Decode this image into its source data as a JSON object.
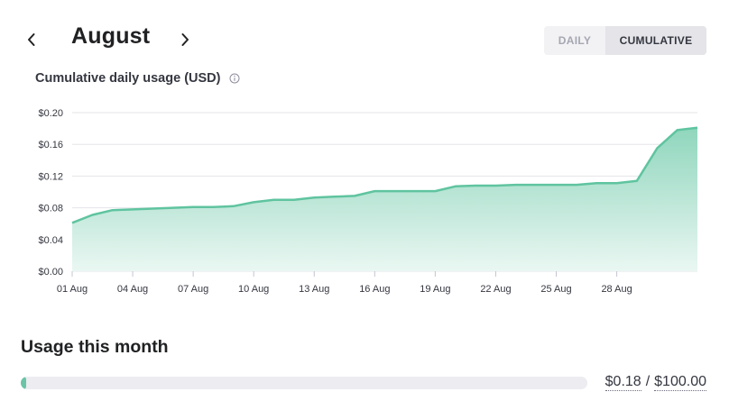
{
  "header": {
    "month": "August",
    "toggle": {
      "daily_label": "DAILY",
      "cumulative_label": "CUMULATIVE",
      "active": "cumulative"
    }
  },
  "chart_data": {
    "type": "area",
    "title": "Cumulative daily usage (USD)",
    "x": [
      "01 Aug",
      "02 Aug",
      "03 Aug",
      "04 Aug",
      "05 Aug",
      "06 Aug",
      "07 Aug",
      "08 Aug",
      "09 Aug",
      "10 Aug",
      "11 Aug",
      "12 Aug",
      "13 Aug",
      "14 Aug",
      "15 Aug",
      "16 Aug",
      "17 Aug",
      "18 Aug",
      "19 Aug",
      "20 Aug",
      "21 Aug",
      "22 Aug",
      "23 Aug",
      "24 Aug",
      "25 Aug",
      "26 Aug",
      "27 Aug",
      "28 Aug",
      "29 Aug",
      "30 Aug",
      "31 Aug"
    ],
    "values": [
      0.061,
      0.071,
      0.077,
      0.078,
      0.079,
      0.08,
      0.081,
      0.081,
      0.082,
      0.087,
      0.09,
      0.09,
      0.093,
      0.094,
      0.095,
      0.101,
      0.101,
      0.101,
      0.101,
      0.107,
      0.108,
      0.108,
      0.109,
      0.109,
      0.109,
      0.109,
      0.111,
      0.111,
      0.114,
      0.155,
      0.178,
      0.181
    ],
    "xticks": [
      "01 Aug",
      "04 Aug",
      "07 Aug",
      "10 Aug",
      "13 Aug",
      "16 Aug",
      "19 Aug",
      "22 Aug",
      "25 Aug",
      "28 Aug"
    ],
    "yticks": [
      "$0.00",
      "$0.04",
      "$0.08",
      "$0.12",
      "$0.16",
      "$0.20"
    ],
    "ylim": [
      0,
      0.2
    ],
    "grid": true,
    "colors": {
      "line": "#5fc4a0",
      "fill_top": "#8fd6bd",
      "fill_bottom": "#eaf7f2",
      "grid": "#e5e5ea"
    }
  },
  "usage": {
    "title": "Usage this month",
    "used": "$0.18",
    "limit": "$100.00",
    "progress_fraction": 0.0018
  }
}
